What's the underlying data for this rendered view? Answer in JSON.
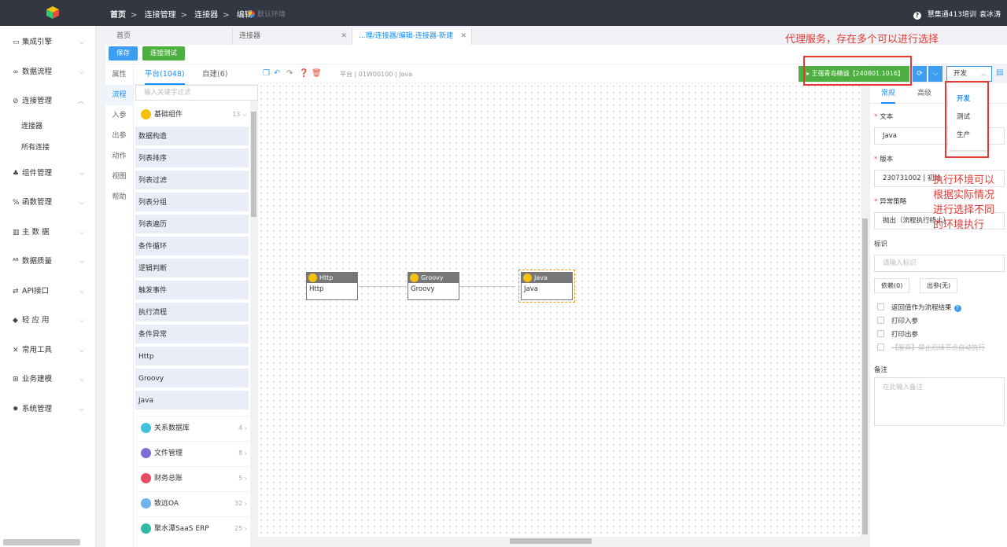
{
  "header": {
    "breadcrumbs": [
      "首页",
      "连接管理",
      "连接器",
      "编辑"
    ],
    "env_label": "默认环境",
    "org": "慧集通413培训",
    "user": "袁冰涛"
  },
  "sidebar": {
    "items": [
      {
        "icon": "▭",
        "label": "集成引擎"
      },
      {
        "icon": "∞",
        "label": "数据流程"
      },
      {
        "icon": "⊘",
        "label": "连接管理"
      },
      {
        "icon": "♣",
        "label": "组件管理"
      },
      {
        "icon": "%",
        "label": "函数管理"
      },
      {
        "icon": "▥",
        "label": "主 数 据"
      },
      {
        "icon": "ᴬᴮ",
        "label": "数据质量"
      },
      {
        "icon": "⇄",
        "label": "API接口"
      },
      {
        "icon": "◆",
        "label": "轻 应 用"
      },
      {
        "icon": "✕",
        "label": "常用工具"
      },
      {
        "icon": "⊞",
        "label": "业务建模"
      },
      {
        "icon": "✹",
        "label": "系统管理"
      }
    ],
    "sub_items": [
      "连接器",
      "所有连接"
    ]
  },
  "tabs": [
    {
      "label": "首页"
    },
    {
      "label": "连接器"
    },
    {
      "label": "...理/连接器/编辑-连接器-新建"
    }
  ],
  "toolbar": {
    "save": "保存",
    "test": "连接测试"
  },
  "vtabs": [
    "属性",
    "流程",
    "入参",
    "出参",
    "动作",
    "视图",
    "帮助"
  ],
  "palette": {
    "tab_platform": "平台(1048)",
    "tab_custom": "自建(6)",
    "search_placeholder": "输入关键字过滤",
    "base_group": {
      "label": "基础组件",
      "count": "13"
    },
    "components": [
      "数据构造",
      "列表排序",
      "列表过滤",
      "列表分组",
      "列表遍历",
      "条件循环",
      "逻辑判断",
      "触发事件",
      "执行流程",
      "条件异常",
      "Http",
      "Groovy",
      "Java"
    ],
    "groups": [
      {
        "label": "关系数据库",
        "count": "4",
        "color": "#3fc1d9"
      },
      {
        "label": "文件管理",
        "count": "8",
        "color": "#7b6fd6"
      },
      {
        "label": "财务总账",
        "count": "5",
        "color": "#e84c62"
      },
      {
        "label": "致远OA",
        "count": "32",
        "color": "#6cb3ef"
      },
      {
        "label": "聚水潭SaaS ERP",
        "count": "25",
        "color": "#2fb9a6"
      }
    ]
  },
  "canvas": {
    "path": "平台 | 01W00100 | Java",
    "nodes": [
      {
        "title": "Http",
        "body": "Http"
      },
      {
        "title": "Groovy",
        "body": "Groovy"
      },
      {
        "title": "Java",
        "body": "Java"
      }
    ]
  },
  "run": {
    "label": "▸ 王强青岛精诚【240801.1016】"
  },
  "env": {
    "selected": "开发",
    "options": [
      "开发",
      "测试",
      "生产"
    ]
  },
  "props": {
    "tab_normal": "常规",
    "tab_advanced": "高级",
    "text_label": "文本",
    "text_value": "Java",
    "version_label": "版本",
    "version_value": "230731002 | 初始",
    "strategy_label": "异常策略",
    "strategy_value": "抛出（流程执行终止）",
    "id_label": "标识",
    "id_placeholder": "请输入标识",
    "deps_button": "依赖(0)",
    "out_button": "出参(无)",
    "checks": [
      "返回值作为流程结果",
      "打印入参",
      "打印出参",
      "【废弃】禁止后续节点自动执行"
    ],
    "remark_label": "备注",
    "remark_placeholder": "在此输入备注"
  },
  "annotations": {
    "proxy": "代理服务，存在多个可以进行选择",
    "env_lines": [
      "执行环境可以",
      "根据实际情况",
      "进行选择不同",
      "的环境执行"
    ]
  }
}
